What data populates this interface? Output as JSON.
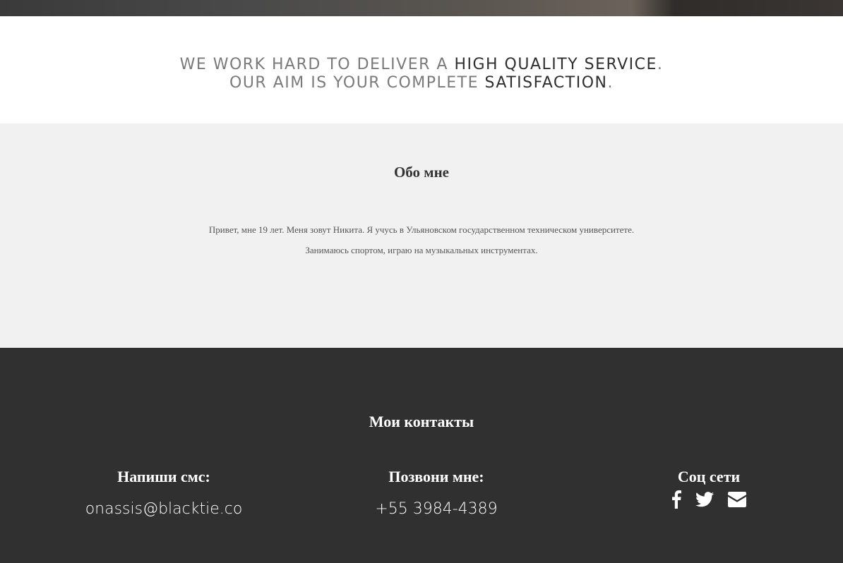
{
  "tagline": {
    "line1_a": "WE WORK HARD TO DELIVER A ",
    "line1_b": "HIGH QUALITY SERVICE",
    "line1_c": ".",
    "line2_a": "OUR AIM IS YOUR COMPLETE ",
    "line2_b": "SATISFACTION",
    "line2_c": "."
  },
  "about": {
    "title": "Обо мне",
    "line1": "Привет, мне 19 лет. Меня зовут Никита. Я учусь в Ульяновском государственном техническом университете.",
    "line2": "Занимаюсь спортом, играю на музыкальных инструментах."
  },
  "footer": {
    "title": "Мои контакты",
    "sms_heading": "Напиши смс:",
    "email": "onassis@blacktie.co",
    "call_heading": "Позвони мне:",
    "phone": "+55 3984-4389",
    "social_heading": "Соц сети",
    "social_icons": [
      "facebook-icon",
      "twitter-icon",
      "envelope-icon"
    ]
  },
  "colors": {
    "tagline_muted": "#7a7a7a",
    "tagline_strong": "#2f2f2f",
    "about_bg": "#f1f1f1",
    "footer_bg": "#303030"
  }
}
